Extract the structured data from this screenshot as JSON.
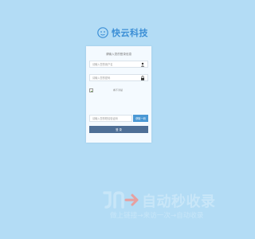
{
  "header": {
    "brand_name": "快云科技",
    "logo_icon": "cloud-face-logo-icon"
  },
  "login_form": {
    "title": "请输入您的登录信息",
    "username": {
      "placeholder": "请输入您的用户名",
      "icon": "user-icon"
    },
    "password": {
      "placeholder": "请输入您的密码",
      "icon": "lock-icon"
    },
    "captcha": {
      "label": "看不清楚"
    },
    "sms_code": {
      "placeholder": "请输入您的短信验证码"
    },
    "send_code_label": "获取一码",
    "login_label": "登 录"
  },
  "watermark": {
    "title": "自动秒收录",
    "slogan": "做上链接→来访一次→自动收录"
  },
  "colors": {
    "background": "#b3dcf5",
    "card": "#f4faff",
    "brand": "#3c8fd6",
    "send_button": "#4a98d4",
    "login_button": "#4e6f96"
  }
}
